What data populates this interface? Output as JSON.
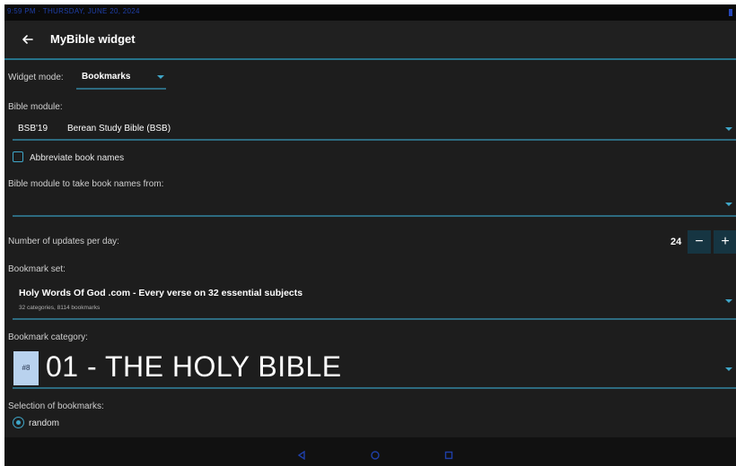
{
  "statusbar": {
    "text": "9:59 PM · THURSDAY, JUNE 20, 2024"
  },
  "appbar": {
    "title": "MyBible widget",
    "back_icon": "arrow-left-icon"
  },
  "widget_mode": {
    "label": "Widget mode:",
    "value": "Bookmarks"
  },
  "bible_module": {
    "label": "Bible module:",
    "abbr": "BSB'19",
    "name": "Berean Study Bible (BSB)"
  },
  "abbreviate": {
    "label": "Abbreviate book names",
    "checked": false
  },
  "book_names_module": {
    "label": "Bible module to take book names from:",
    "value": ""
  },
  "updates": {
    "label": "Number of updates per day:",
    "value": "24",
    "minus": "−",
    "plus": "+"
  },
  "bookmark_set": {
    "label": "Bookmark set:",
    "title": "Holy Words Of God .com - Every verse on 32 essential subjects",
    "subtitle": "32 categories, 8114 bookmarks"
  },
  "bookmark_category": {
    "label": "Bookmark category:",
    "badge": "#8",
    "value": "01 - THE HOLY BIBLE"
  },
  "selection": {
    "label": "Selection of bookmarks:",
    "option": "random",
    "selected": true
  },
  "navbar": {
    "icons": [
      "back-triangle-icon",
      "home-circle-icon",
      "recents-square-icon"
    ]
  },
  "colors": {
    "accent": "#3fa6c8",
    "divider": "#2d6b80",
    "background": "#1d1d1d",
    "badge": "#b9d2ee"
  }
}
